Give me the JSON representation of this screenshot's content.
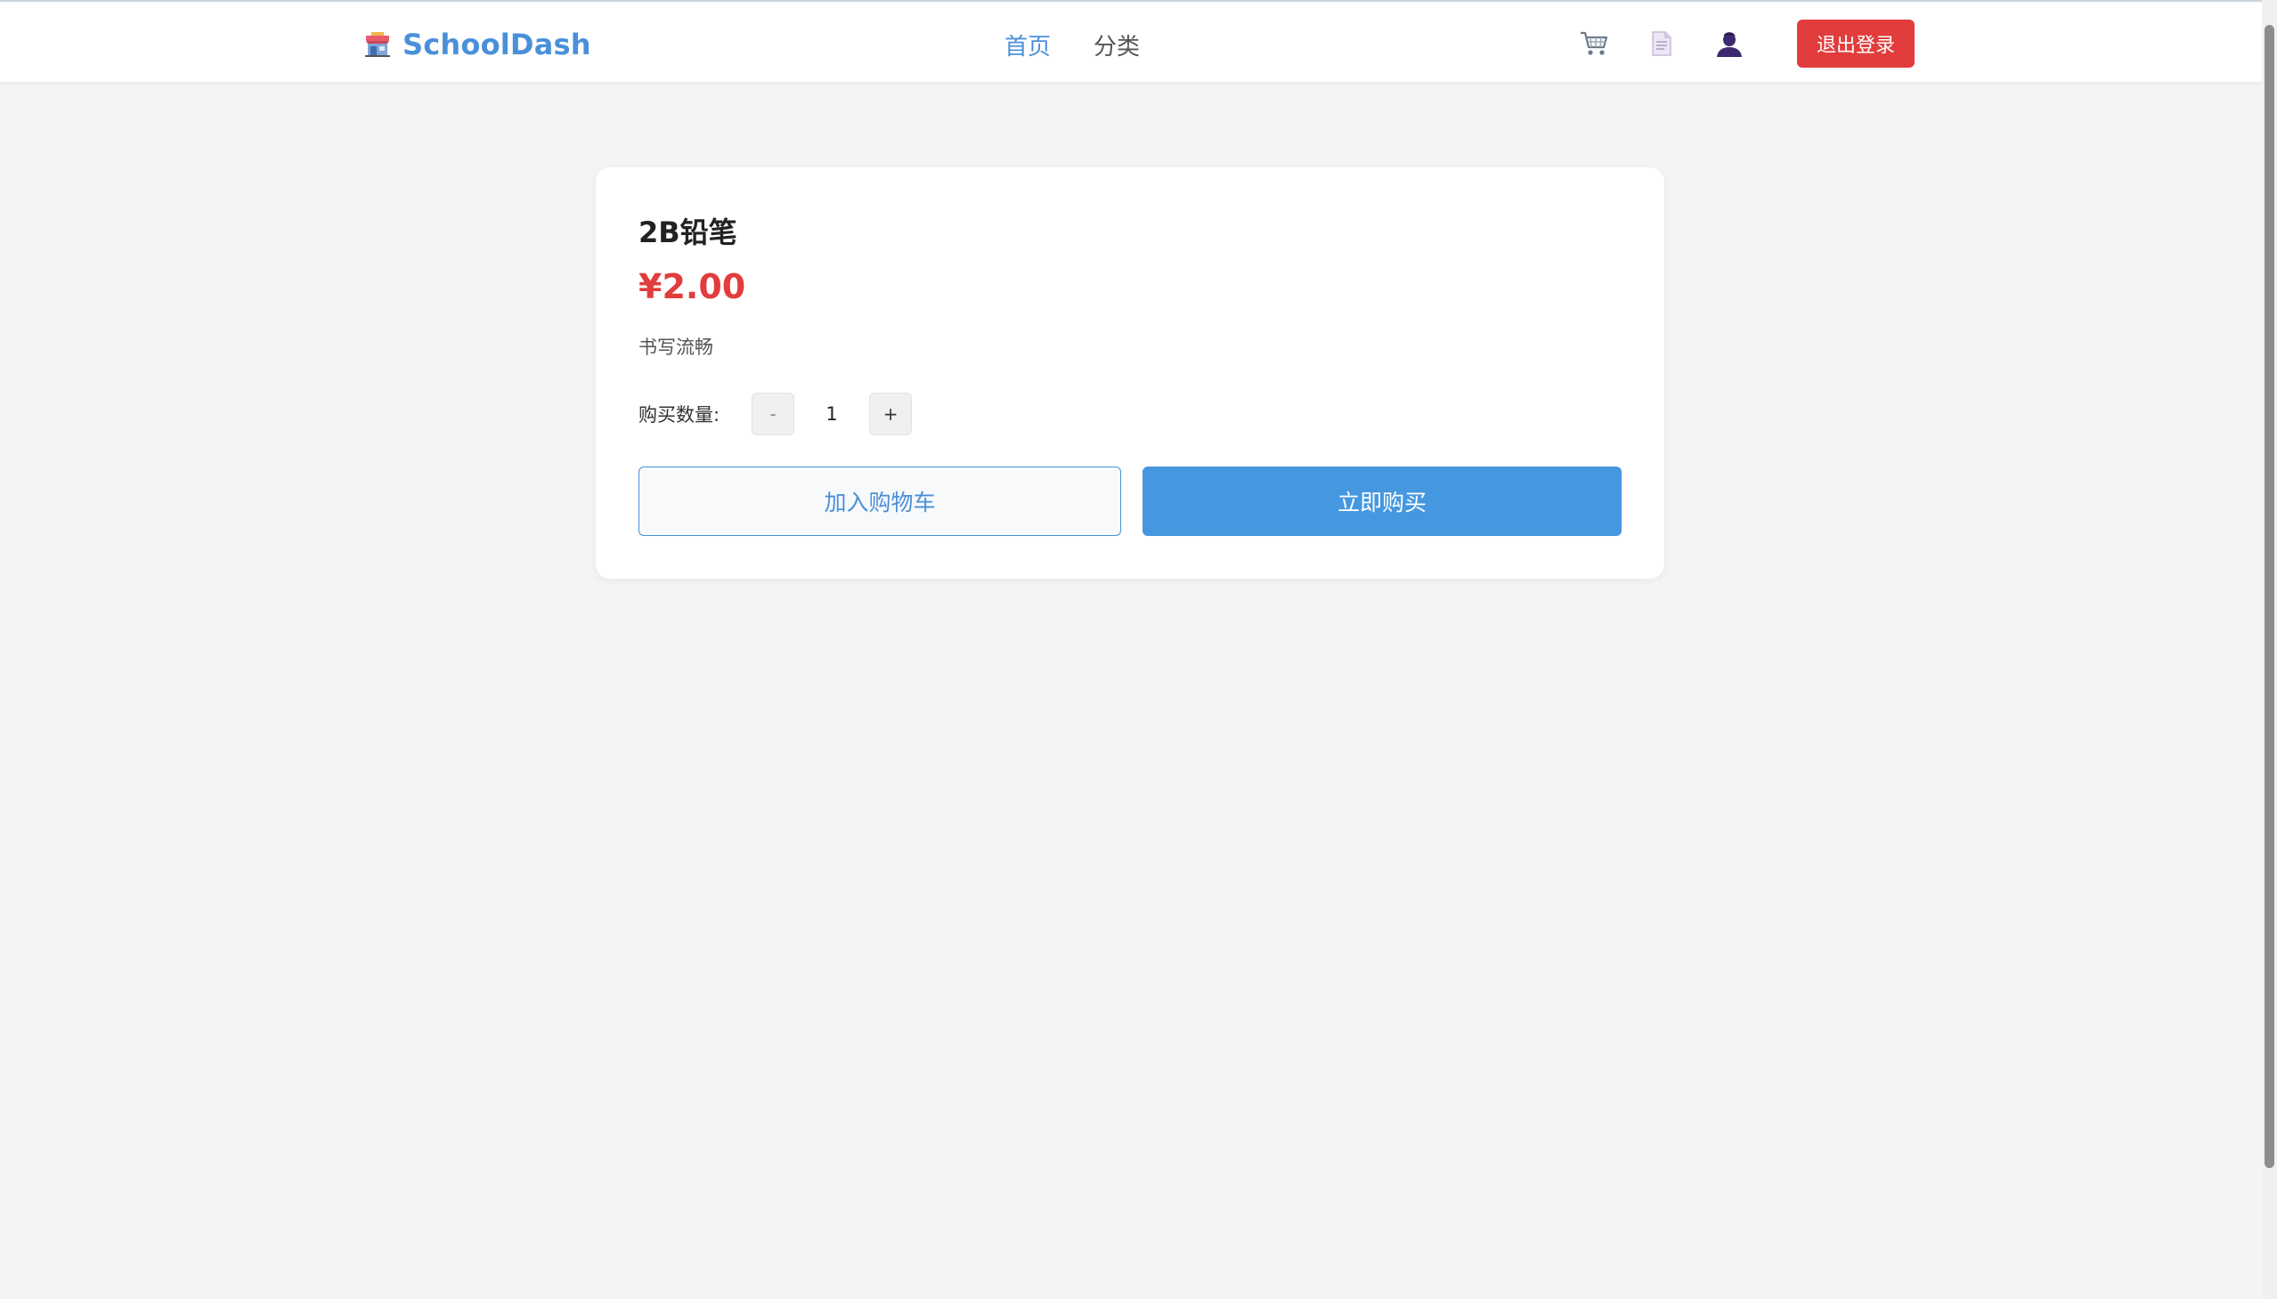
{
  "header": {
    "logo_text": "SchoolDash",
    "nav": [
      {
        "label": "首页",
        "active": true
      },
      {
        "label": "分类",
        "active": false
      }
    ],
    "icons": [
      "cart-icon",
      "order-document-icon",
      "user-icon"
    ],
    "logout_label": "退出登录"
  },
  "product": {
    "name": "2B铅笔",
    "price": "¥2.00",
    "description": "书写流畅",
    "quantity_label": "购买数量:",
    "quantity": "1",
    "minus_label": "-",
    "plus_label": "+",
    "add_to_cart_label": "加入购物车",
    "buy_now_label": "立即购买"
  },
  "colors": {
    "brand": "#4a90d9",
    "danger": "#e23c3c",
    "buy_button": "#4597e0",
    "page_background": "#f4f4f4"
  }
}
